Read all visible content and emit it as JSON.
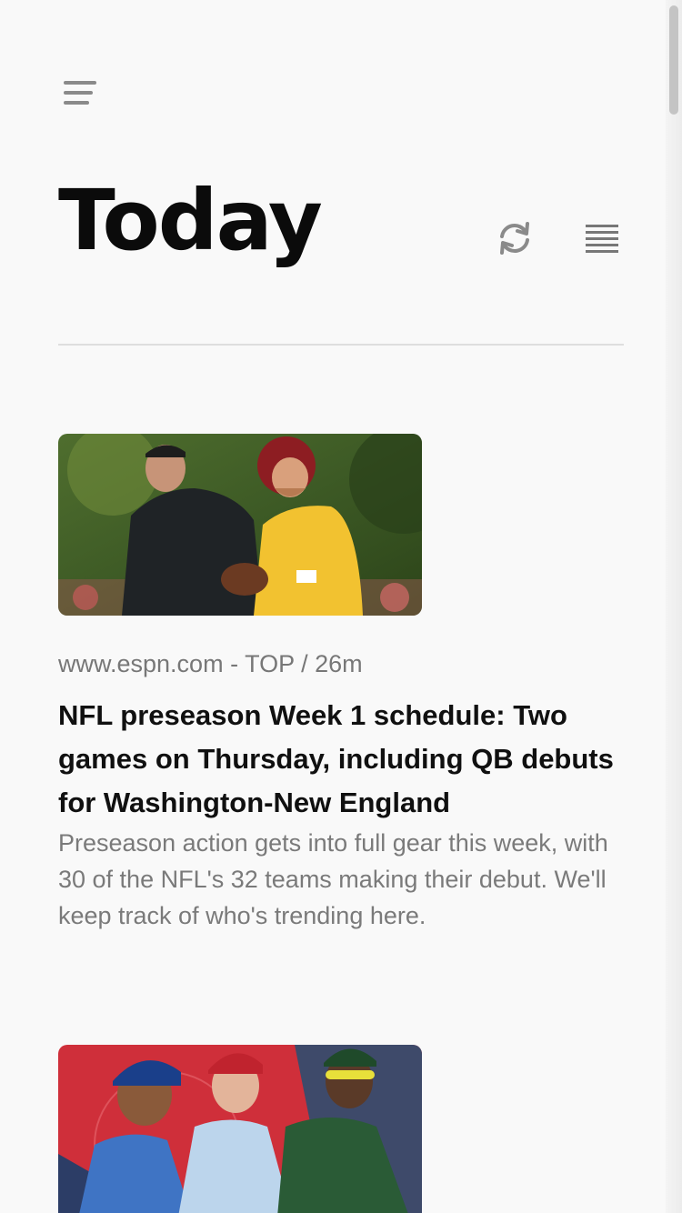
{
  "header": {
    "menu_icon": "hamburger-menu-icon",
    "title": "Today",
    "refresh_icon": "refresh-icon",
    "list_icon": "list-view-icon"
  },
  "articles": [
    {
      "source": "www.espn.com",
      "separator": "-",
      "category": "TOP / 26m",
      "headline": "NFL preseason Week 1 schedule: Two games on Thursday, including QB debuts for Washington-New England",
      "summary": "Preseason action gets into full gear this week, with 30 of the NFL's 32 teams making their debut. We'll keep track of who's trending here.",
      "image_desc": "football-players-photo"
    },
    {
      "image_desc": "baseball-players-photo"
    }
  ],
  "colors": {
    "background": "#f9f9f9",
    "title": "#0b0b0b",
    "meta": "#777777",
    "summary": "#7a7a7a",
    "icon": "#888888"
  }
}
